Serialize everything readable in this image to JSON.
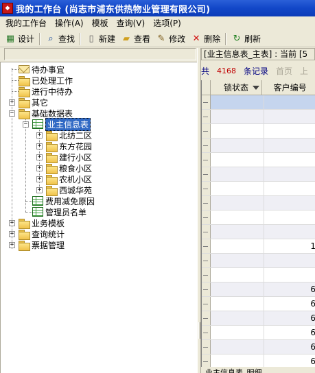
{
  "window": {
    "title": "我的工作台 (尚志市浦东供热物业管理有限公司)"
  },
  "menubar": {
    "items": [
      "我的工作台",
      "操作(A)",
      "模板",
      "查询(V)",
      "选项(P)"
    ]
  },
  "toolbar": {
    "design": "设计",
    "find": "查找",
    "new": "新建",
    "view": "查看",
    "edit": "修改",
    "delete": "删除",
    "refresh": "刷新"
  },
  "tree": {
    "todo": "待办事宜",
    "processed": "已处理工作",
    "in_progress": "进行中待办",
    "other": "其它",
    "base_tables": "基础数据表",
    "owner_info": "业主信息表",
    "districts": [
      "北纺二区",
      "东方花园",
      "建行小区",
      "粮食小区",
      "农机小区",
      "西城华苑"
    ],
    "fee_reason": "费用减免原因",
    "admin_list": "管理员名单",
    "business_template": "业务模板",
    "query_stats": "查询统计",
    "ticket_mgmt": "票据管理"
  },
  "right": {
    "title": "[业主信息表_主表] : 当前 [5",
    "nav": {
      "prefix": "共",
      "count": "4168",
      "unit": "条记录",
      "first": "首页",
      "prev": "上"
    },
    "grid": {
      "columns": [
        "锁状态",
        "客户编号"
      ],
      "rows": [
        "",
        "",
        "",
        "",
        "",
        "",
        "",
        "",
        "",
        "",
        "1",
        "",
        "",
        "6",
        "6",
        "6",
        "6",
        "6",
        "6",
        "6"
      ]
    },
    "bottom_tab": "业主信息表_明细"
  }
}
